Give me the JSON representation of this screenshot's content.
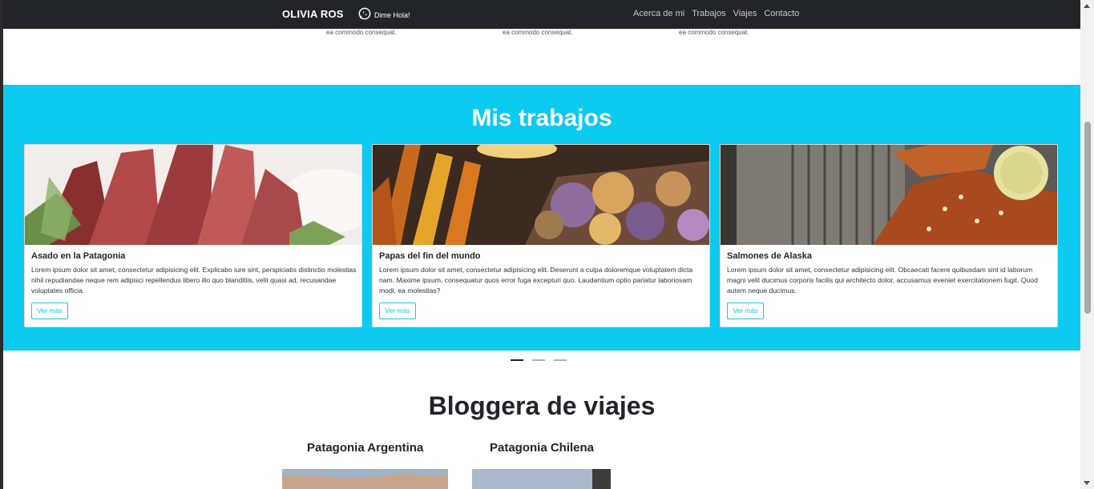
{
  "navbar": {
    "brand": "OLIVIA ROS",
    "whatsapp_label": "Dime Hola!",
    "links": [
      "Acerca de mi",
      "Trabajos",
      "Viajes",
      "Contacto"
    ]
  },
  "top_snippets": [
    "ea commodo consequat.",
    "ea commodo consequat.",
    "ea commodo consequat."
  ],
  "works": {
    "title": "Mis trabajos",
    "cards": [
      {
        "title": "Asado en la Patagonia",
        "text": "Lorem ipsum dolor sit amet, consectetur adipisicing elit. Explicabo iure sint, perspiciatis distinctio molestias nihil repudiandae neque rem adipisci repellendus libero illo quo blanditiis, velit quasi ad, recusandae voluptates officia.",
        "button": "Ver más"
      },
      {
        "title": "Papas del fin del mundo",
        "text": "Lorem ipsum dolor sit amet, consectetur adipisicing elit. Deserunt a culpa doloremque voluptatem dicta nam. Maxime ipsum, consequatur quos error fuga excepturi quo. Laudantium optio pariatur laboriosam modi, ea molestias?",
        "button": "Ver más"
      },
      {
        "title": "Salmones de Alaska",
        "text": "Lorem ipsum dolor sit amet, consectetur adipisicing elit. Obcaecati facere quibusdam sint id laborum magni velit ducimus corporis facilis qui architecto dolor, accusamus eveniet exercitationem fugit. Quod autem neque ducimus.",
        "button": "Ver más"
      }
    ]
  },
  "carousel": {
    "active_index": 0,
    "count": 3
  },
  "blog": {
    "title": "Bloggera de viajes",
    "items": [
      "Patagonia Argentina",
      "Patagonia Chilena"
    ]
  },
  "colors": {
    "navbar": "#212529",
    "accent": "#0dcaf0",
    "text": "#212529"
  }
}
